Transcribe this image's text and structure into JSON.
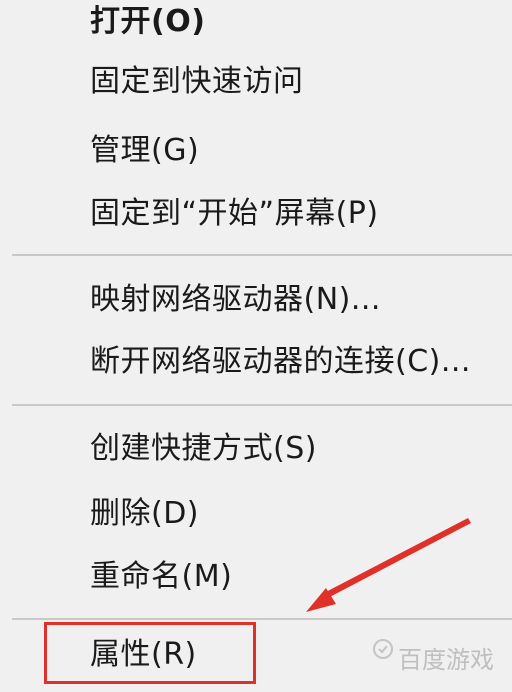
{
  "menu": {
    "items": [
      {
        "label": "打开(O)"
      },
      {
        "label": "固定到快速访问"
      },
      {
        "label": "管理(G)"
      },
      {
        "label": "固定到“开始”屏幕(P)"
      },
      {
        "label": "映射网络驱动器(N)..."
      },
      {
        "label": "断开网络驱动器的连接(C)..."
      },
      {
        "label": "创建快捷方式(S)"
      },
      {
        "label": "删除(D)"
      },
      {
        "label": "重命名(M)"
      },
      {
        "label": "属性(R)"
      }
    ]
  },
  "annotation": {
    "highlight_color": "#e0302a",
    "arrow_color": "#e0302a"
  },
  "watermark": {
    "text": "百度游戏"
  }
}
